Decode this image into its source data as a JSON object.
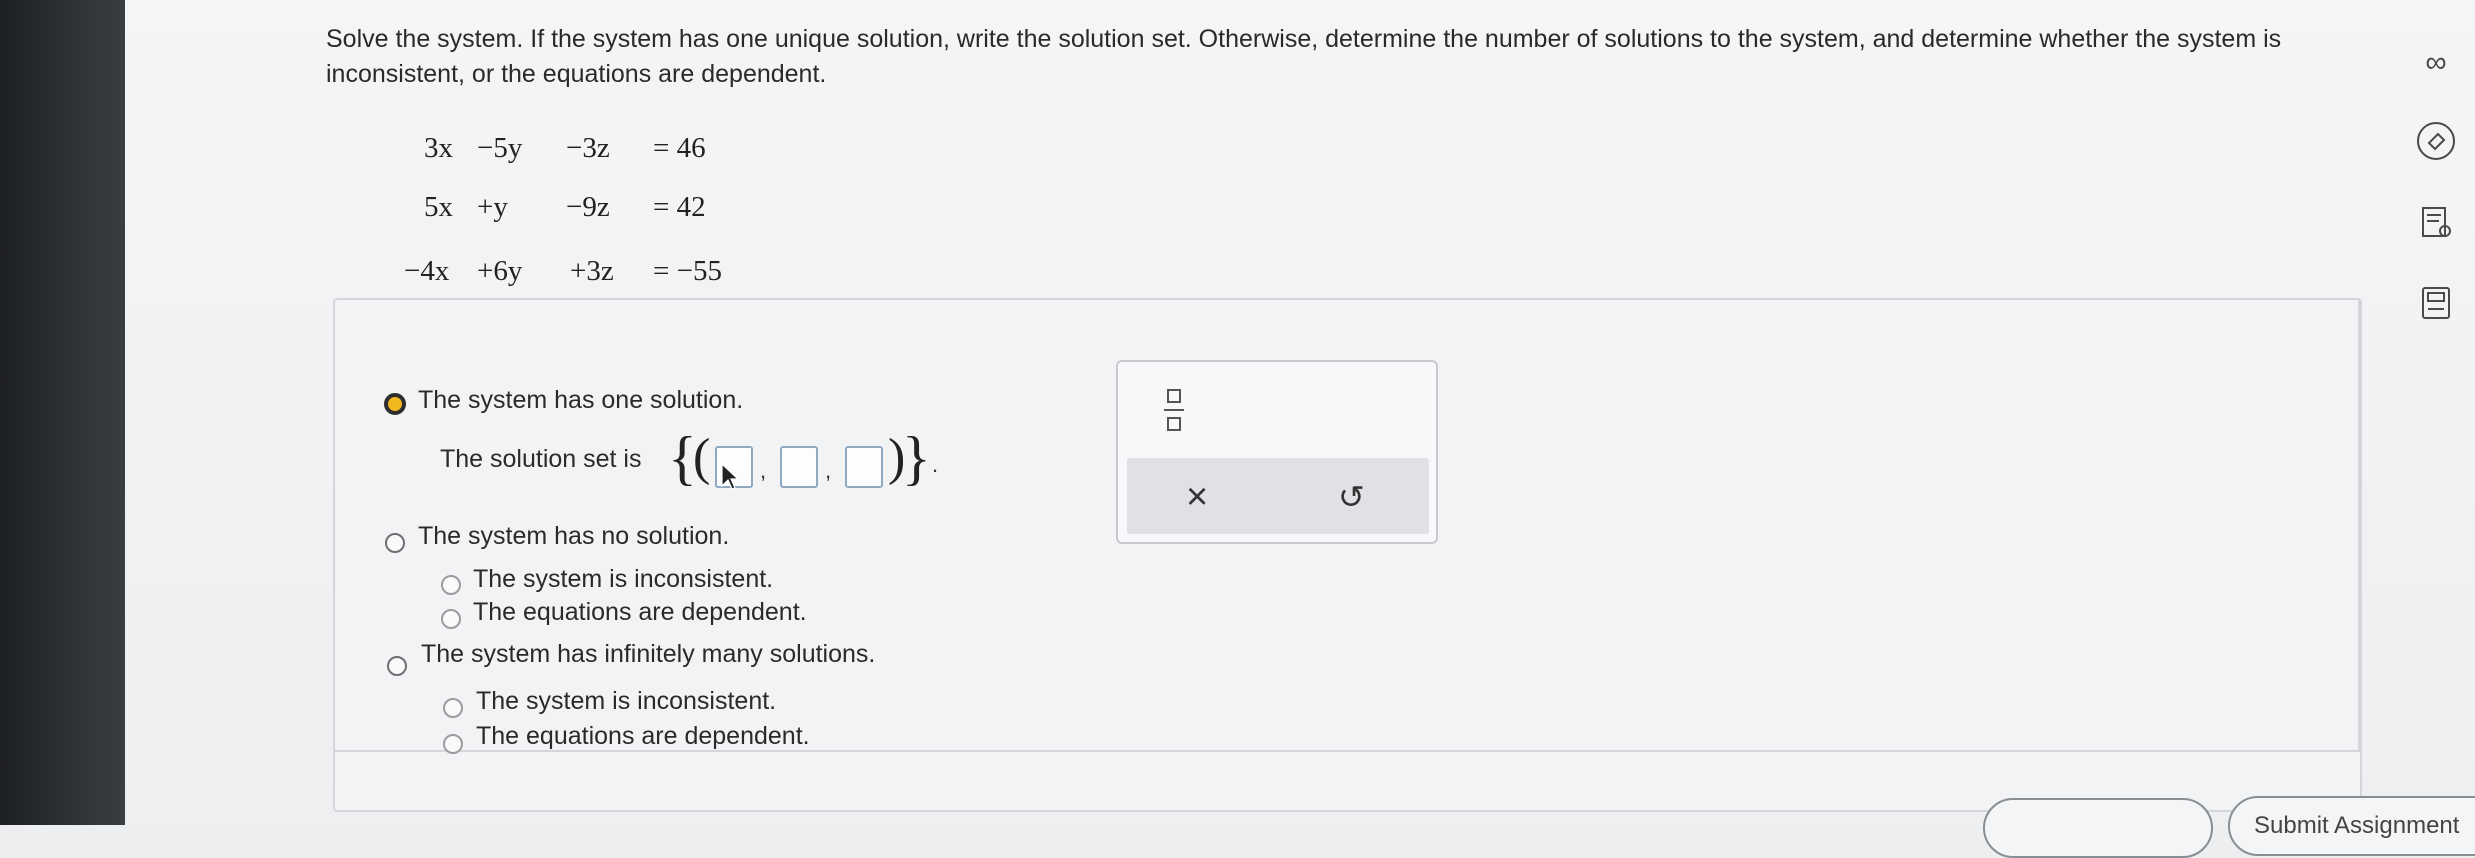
{
  "prompt": "Solve the system. If the system has one unique solution, write the solution set. Otherwise, determine the number of solutions to the system, and determine whether the system is inconsistent, or the equations are dependent.",
  "equations": [
    {
      "a": "3x",
      "b": "−5y",
      "c": "−3z",
      "rhs": "= 46"
    },
    {
      "a": "5x",
      "b": "+y",
      "c": "−9z",
      "rhs": "= 42"
    },
    {
      "a": "−4x",
      "b": "+6y",
      "c": "+3z",
      "rhs": "= −55"
    }
  ],
  "options": {
    "one_solution": "The system has one solution.",
    "solution_set_label": "The solution set is",
    "no_solution": "The system has no solution.",
    "no_inconsistent": "The system is inconsistent.",
    "no_dependent": "The equations are dependent.",
    "infinite": "The system has infinitely many solutions.",
    "inf_inconsistent": "The system is inconsistent.",
    "inf_dependent": "The equations are dependent."
  },
  "selected_option": "one_solution",
  "solution_inputs": [
    "",
    "",
    ""
  ],
  "palette": {
    "clear_symbol": "×",
    "undo_symbol": "↺"
  },
  "side_tools": [
    "infinity-icon",
    "tag-icon",
    "notes-icon",
    "calculator-icon"
  ],
  "side_tool_glyphs": {
    "infinity": "∞"
  },
  "submit_label": "Submit Assignment",
  "colors": {
    "selected_radio": "#f0b81c",
    "input_border": "#8fa9c2"
  }
}
